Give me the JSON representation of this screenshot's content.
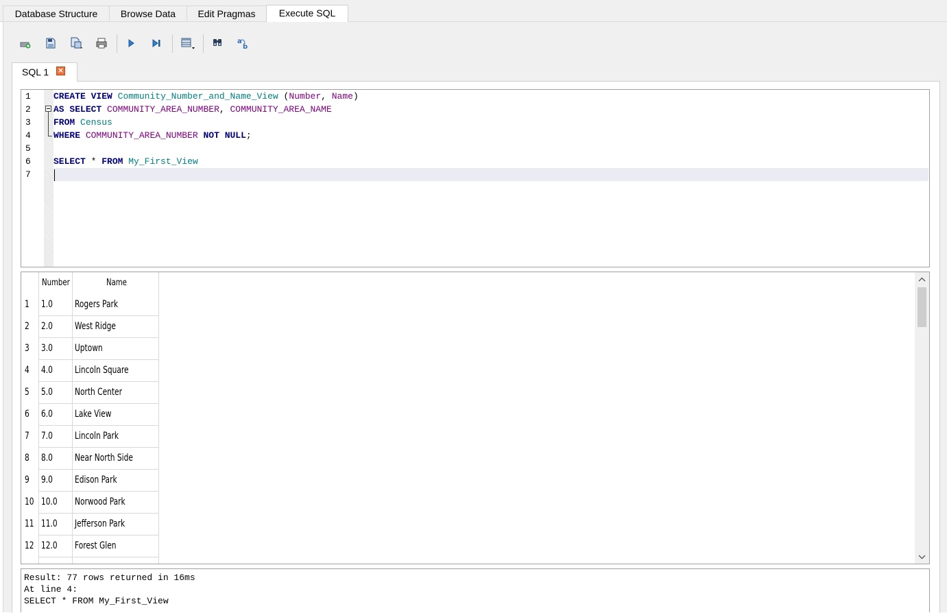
{
  "tabs": [
    "Database Structure",
    "Browse Data",
    "Edit Pragmas",
    "Execute SQL"
  ],
  "active_tab": "Execute SQL",
  "toolbar": {
    "icons": [
      "open-tab-icon",
      "open-sql-file-icon",
      "save-sql-file-icon",
      "print-icon",
      "execute-all-icon",
      "execute-current-line-icon",
      "save-results-icon",
      "find-icon",
      "find-replace-icon"
    ]
  },
  "editor_tab": {
    "label": "SQL 1"
  },
  "editor": {
    "line_numbers": [
      "1",
      "2",
      "3",
      "4",
      "5",
      "6",
      "7"
    ],
    "lines": [
      "CREATE VIEW Community_Number_and_Name_View (Number, Name)",
      "AS SELECT COMMUNITY_AREA_NUMBER, COMMUNITY_AREA_NAME",
      "FROM Census",
      "WHERE COMMUNITY_AREA_NUMBER NOT NULL;",
      "",
      "SELECT * FROM My_First_View",
      ""
    ]
  },
  "results": {
    "columns": [
      "Number",
      "Name"
    ],
    "rows": [
      {
        "n": "1",
        "number": "1.0",
        "name": "Rogers Park"
      },
      {
        "n": "2",
        "number": "2.0",
        "name": "West Ridge"
      },
      {
        "n": "3",
        "number": "3.0",
        "name": "Uptown"
      },
      {
        "n": "4",
        "number": "4.0",
        "name": "Lincoln Square"
      },
      {
        "n": "5",
        "number": "5.0",
        "name": "North Center"
      },
      {
        "n": "6",
        "number": "6.0",
        "name": "Lake View"
      },
      {
        "n": "7",
        "number": "7.0",
        "name": "Lincoln Park"
      },
      {
        "n": "8",
        "number": "8.0",
        "name": "Near North Side"
      },
      {
        "n": "9",
        "number": "9.0",
        "name": "Edison Park"
      },
      {
        "n": "10",
        "number": "10.0",
        "name": "Norwood Park"
      },
      {
        "n": "11",
        "number": "11.0",
        "name": "Jefferson Park"
      },
      {
        "n": "12",
        "number": "12.0",
        "name": "Forest Glen"
      }
    ]
  },
  "message": {
    "line1": "Result: 77 rows returned in 16ms",
    "line2": "At line 4:",
    "line3": "SELECT * FROM My_First_View"
  }
}
